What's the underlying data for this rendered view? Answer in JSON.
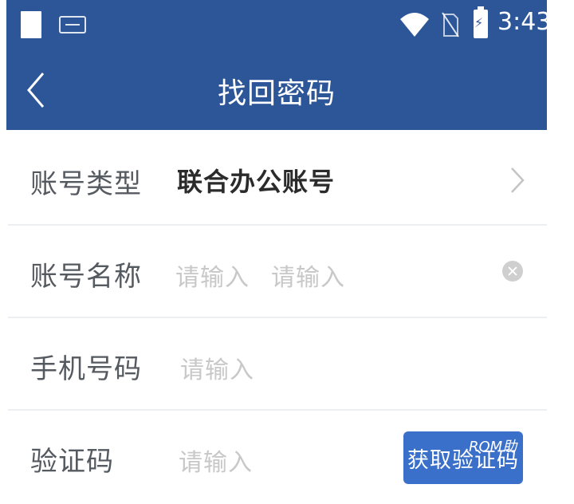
{
  "status_bar": {
    "time": "3:43"
  },
  "header": {
    "title": "找回密码"
  },
  "form": {
    "account_type": {
      "label": "账号类型",
      "value": "联合办公账号"
    },
    "account_name": {
      "label": "账号名称",
      "placeholder_1": "请输入",
      "placeholder_2": "请输入"
    },
    "phone": {
      "label": "手机号码",
      "placeholder": "请输入"
    },
    "verification": {
      "label": "验证码",
      "placeholder": "请输入",
      "button_label": "获取验证码"
    }
  },
  "watermark": "ROM助",
  "colors": {
    "header_bg": "#2c5698",
    "button_bg": "#3a70c9"
  }
}
